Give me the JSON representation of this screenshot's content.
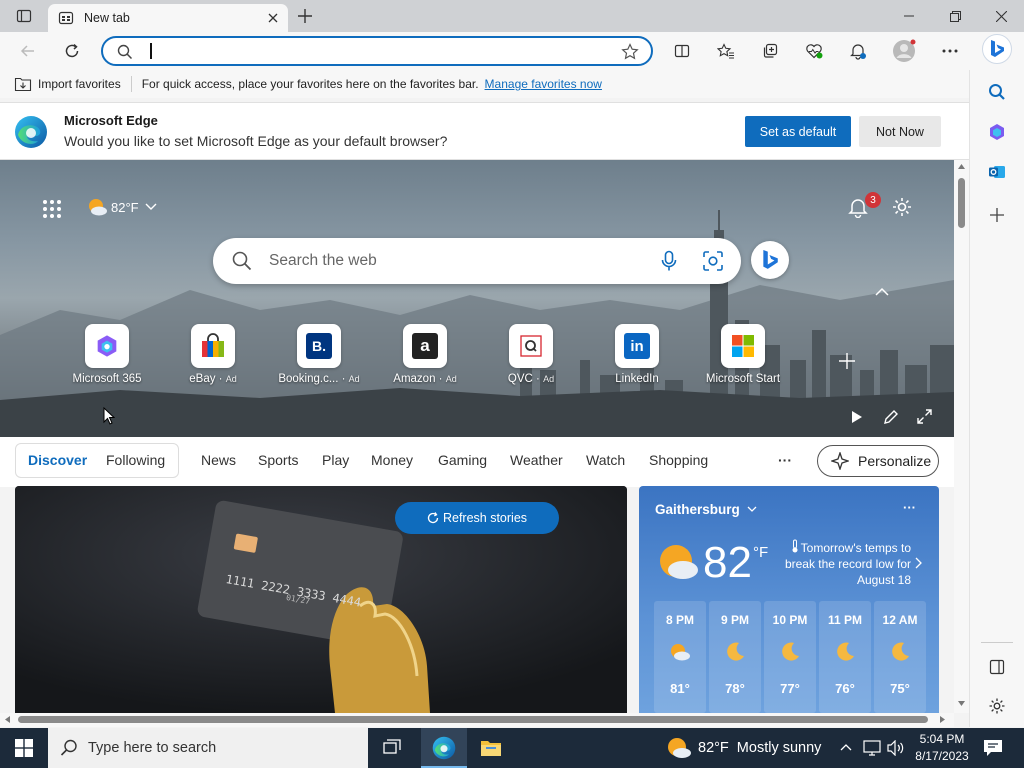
{
  "tab": {
    "title": "New tab"
  },
  "favorites_bar": {
    "import_label": "Import favorites",
    "message": "For quick access, place your favorites here on the favorites bar.",
    "manage_link": "Manage favorites now"
  },
  "default_prompt": {
    "title": "Microsoft Edge",
    "message": "Would you like to set Microsoft Edge as your default browser?",
    "set_default_button": "Set as default",
    "not_now_button": "Not Now"
  },
  "hero": {
    "weather_temp": "82°F",
    "notification_count": "3",
    "search_placeholder": "Search the web"
  },
  "quick_links": [
    {
      "label": "Microsoft 365",
      "ad": ""
    },
    {
      "label": "eBay",
      "ad": "Ad"
    },
    {
      "label": "Booking.c...",
      "ad": "Ad"
    },
    {
      "label": "Amazon",
      "ad": "Ad"
    },
    {
      "label": "QVC",
      "ad": "Ad"
    },
    {
      "label": "LinkedIn",
      "ad": ""
    },
    {
      "label": "Microsoft Start",
      "ad": ""
    }
  ],
  "feed_nav": {
    "discover": "Discover",
    "following": "Following",
    "items": [
      "News",
      "Sports",
      "Play",
      "Money",
      "Gaming",
      "Weather",
      "Watch",
      "Shopping"
    ],
    "more": "···",
    "personalize": "Personalize"
  },
  "story": {
    "refresh_label": "Refresh stories",
    "card_number": "1111 2222 3333 4444",
    "card_expiry": "01/27"
  },
  "weather_card": {
    "location": "Gaithersburg",
    "temp": "82",
    "unit": "°F",
    "tip": "Tomorrow's temps to break the record low for August 18",
    "hourly": [
      {
        "time": "8 PM",
        "temp": "81°"
      },
      {
        "time": "9 PM",
        "temp": "78°"
      },
      {
        "time": "10 PM",
        "temp": "77°"
      },
      {
        "time": "11 PM",
        "temp": "76°"
      },
      {
        "time": "12 AM",
        "temp": "75°"
      }
    ]
  },
  "taskbar": {
    "search_placeholder": "Type here to search",
    "weather_temp": "82°F",
    "weather_desc": "Mostly sunny",
    "time": "5:04 PM",
    "date": "8/17/2023"
  },
  "colors": {
    "accent": "#0f6cbd",
    "taskbar": "#1c2a3a"
  }
}
